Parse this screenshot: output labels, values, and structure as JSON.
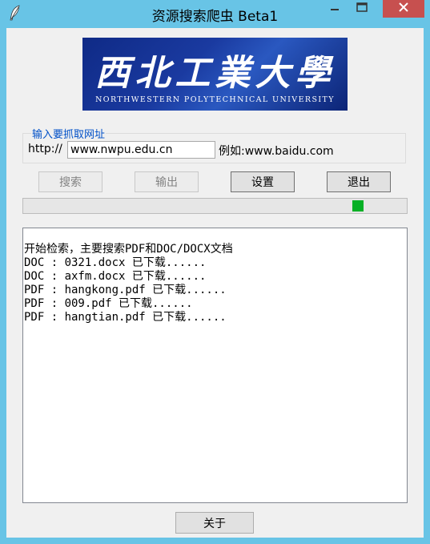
{
  "window": {
    "title": "资源搜索爬虫 Beta1",
    "controls": {
      "minimize": "minimize-icon",
      "maximize": "maximize-icon",
      "close": "close-icon"
    },
    "accent_color": "#68c4e6"
  },
  "logo": {
    "chinese_name": "西北工業大學",
    "english_name": "NORTHWESTERN POLYTECHNICAL UNIVERSITY"
  },
  "url_group": {
    "label": "输入要抓取网址",
    "prefix": "http://",
    "value": "www.nwpu.edu.cn",
    "example": "例如:www.baidu.com"
  },
  "buttons": {
    "search": "搜索",
    "output": "输出",
    "settings": "设置",
    "exit": "退出",
    "about": "关于"
  },
  "progress": {
    "value_fraction": 0.87,
    "color": "#06b025"
  },
  "log": {
    "lines": [
      "开始检索，主要搜索PDF和DOC/DOCX文档",
      "DOC : 0321.docx 已下载......",
      "DOC : axfm.docx 已下载......",
      "PDF : hangkong.pdf 已下载......",
      "PDF : 009.pdf 已下载......",
      "PDF : hangtian.pdf 已下载......"
    ]
  }
}
